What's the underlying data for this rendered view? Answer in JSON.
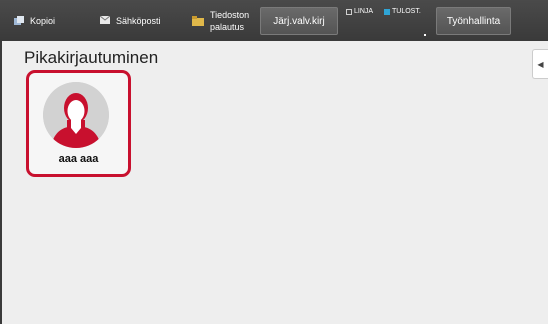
{
  "topbar": {
    "tabs": [
      {
        "label": "Kopioi",
        "icon": "copy-icon"
      },
      {
        "label": "Sähköposti",
        "icon": "email-icon"
      },
      {
        "label": "Tiedoston palautus",
        "icon": "folder-icon"
      }
    ],
    "job_button_label": "Järj.valv.kirj",
    "status": {
      "line_label": "LINJA",
      "print_label": "TULOST.",
      "print_color": "#2fa5d6"
    },
    "work_button_label": "Työnhallinta"
  },
  "main": {
    "title": "Pikakirjautuminen",
    "side_tab_icon": "collapse-arrow-icon",
    "users": [
      {
        "name": "aaa aaa",
        "avatar": "user-silhouette-icon",
        "accent": "#c8102e"
      }
    ]
  }
}
